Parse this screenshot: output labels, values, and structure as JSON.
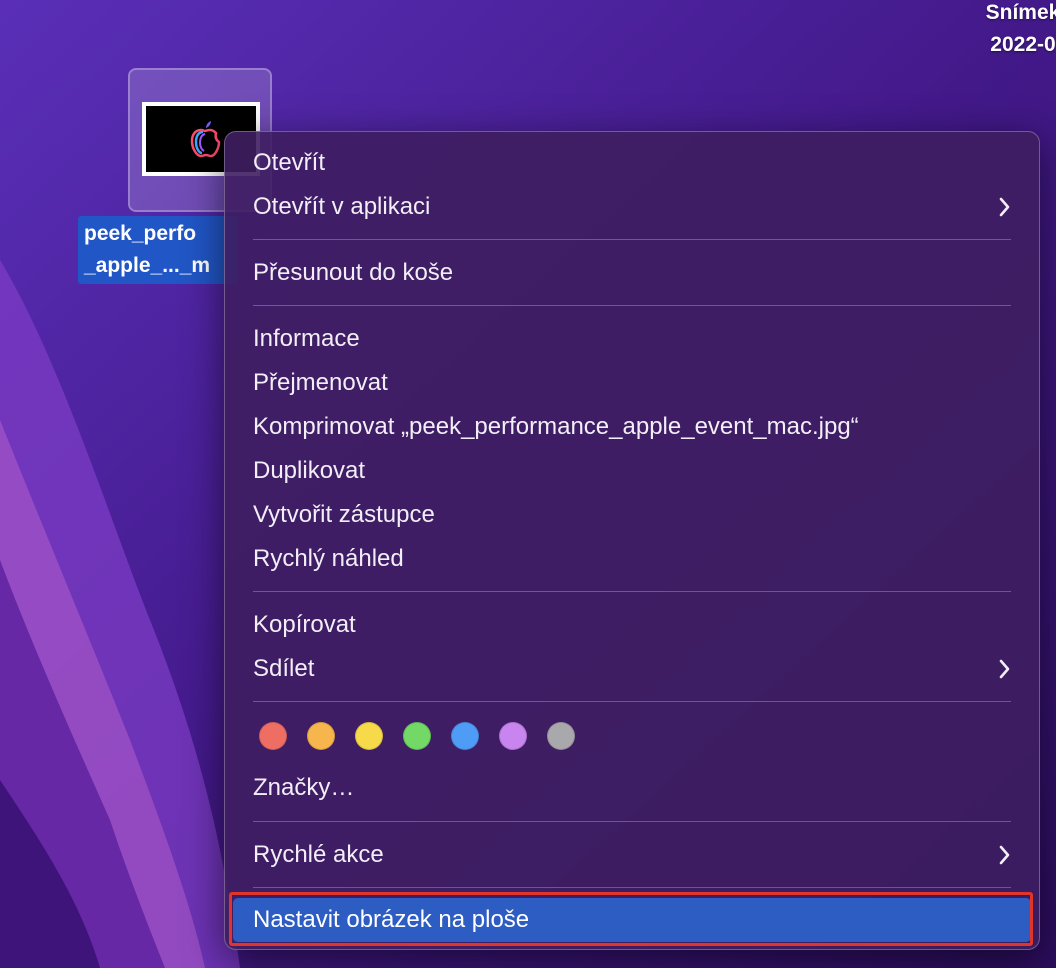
{
  "desktop": {
    "corner_file_label_line1": "Snímek",
    "corner_file_label_line2": "2022-0",
    "file_icon": "image-file-thumbnail-icon",
    "file_name_line1": "peek_perfo",
    "file_name_line2": "_apple_..._m"
  },
  "context_menu": {
    "items": [
      {
        "label": "Otevřít"
      },
      {
        "label": "Otevřít v aplikaci",
        "submenu": true
      },
      {
        "label": "Přesunout do koše"
      },
      {
        "label": "Informace"
      },
      {
        "label": "Přejmenovat"
      },
      {
        "label": "Komprimovat „peek_performance_apple_event_mac.jpg“"
      },
      {
        "label": "Duplikovat"
      },
      {
        "label": "Vytvořit zástupce"
      },
      {
        "label": "Rychlý náhled"
      },
      {
        "label": "Kopírovat"
      },
      {
        "label": "Sdílet",
        "submenu": true
      },
      {
        "label": "Značky…"
      },
      {
        "label": "Rychlé akce",
        "submenu": true
      },
      {
        "label": "Nastavit obrázek na ploše",
        "highlighted": true
      }
    ],
    "tag_colors": [
      {
        "name": "red",
        "color": "#ef6e64"
      },
      {
        "name": "orange",
        "color": "#f7b54d"
      },
      {
        "name": "yellow",
        "color": "#f6da4a"
      },
      {
        "name": "green",
        "color": "#72d866"
      },
      {
        "name": "blue",
        "color": "#4f9cf7"
      },
      {
        "name": "purple",
        "color": "#c885f0"
      },
      {
        "name": "gray",
        "color": "#a9a9ad"
      }
    ],
    "highlight_color": "#2d5cc2",
    "annotation_frame_color": "#e0352b"
  }
}
